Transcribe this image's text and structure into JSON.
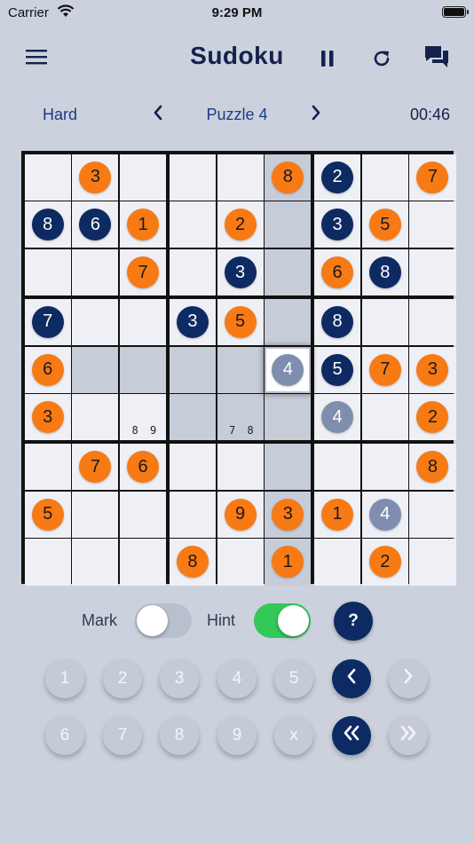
{
  "status": {
    "carrier": "Carrier",
    "time": "9:29 PM"
  },
  "nav": {
    "title": "Sudoku",
    "menu_icon": "hamburger-menu-icon",
    "pause_icon": "pause-icon",
    "restart_icon": "refresh-icon",
    "chat_icon": "chat-bubbles-icon"
  },
  "puzzle": {
    "difficulty": "Hard",
    "label": "Puzzle 4",
    "timer": "00:46"
  },
  "colors": {
    "orange": "#f77a14",
    "navy": "#0e2a63",
    "gray": "#7f8eae",
    "highlight": "#c7ccd9",
    "toggle_on": "#34c759"
  },
  "board": {
    "rows": [
      [
        null,
        {
          "v": "3",
          "c": "orange"
        },
        null,
        null,
        null,
        {
          "v": "8",
          "c": "orange"
        },
        {
          "v": "2",
          "c": "navy"
        },
        null,
        {
          "v": "7",
          "c": "orange"
        }
      ],
      [
        {
          "v": "8",
          "c": "navy"
        },
        {
          "v": "6",
          "c": "navy"
        },
        {
          "v": "1",
          "c": "orange"
        },
        null,
        {
          "v": "2",
          "c": "orange"
        },
        null,
        {
          "v": "3",
          "c": "navy"
        },
        {
          "v": "5",
          "c": "orange"
        },
        null
      ],
      [
        null,
        null,
        {
          "v": "7",
          "c": "orange"
        },
        null,
        {
          "v": "3",
          "c": "navy"
        },
        null,
        {
          "v": "6",
          "c": "orange"
        },
        {
          "v": "8",
          "c": "navy"
        },
        null
      ],
      [
        {
          "v": "7",
          "c": "navy"
        },
        null,
        null,
        {
          "v": "3",
          "c": "navy"
        },
        {
          "v": "5",
          "c": "orange"
        },
        null,
        {
          "v": "8",
          "c": "navy"
        },
        null,
        null
      ],
      [
        {
          "v": "6",
          "c": "orange"
        },
        null,
        null,
        null,
        null,
        {
          "v": "4",
          "c": "gray"
        },
        {
          "v": "5",
          "c": "navy"
        },
        {
          "v": "7",
          "c": "orange"
        },
        {
          "v": "3",
          "c": "orange"
        }
      ],
      [
        {
          "v": "3",
          "c": "orange"
        },
        null,
        {
          "notes": "8 9"
        },
        null,
        {
          "notes": "7 8"
        },
        null,
        {
          "v": "4",
          "c": "gray"
        },
        null,
        {
          "v": "2",
          "c": "orange"
        }
      ],
      [
        null,
        {
          "v": "7",
          "c": "orange"
        },
        {
          "v": "6",
          "c": "orange"
        },
        null,
        null,
        null,
        null,
        null,
        {
          "v": "8",
          "c": "orange"
        }
      ],
      [
        {
          "v": "5",
          "c": "orange"
        },
        null,
        null,
        null,
        {
          "v": "9",
          "c": "orange"
        },
        {
          "v": "3",
          "c": "orange"
        },
        {
          "v": "1",
          "c": "orange"
        },
        {
          "v": "4",
          "c": "gray"
        },
        null
      ],
      [
        null,
        null,
        null,
        {
          "v": "8",
          "c": "orange"
        },
        null,
        {
          "v": "1",
          "c": "orange"
        },
        null,
        {
          "v": "2",
          "c": "orange"
        },
        null
      ]
    ],
    "selected": [
      4,
      5
    ],
    "highlighted": [
      [
        0,
        5
      ],
      [
        1,
        5
      ],
      [
        2,
        5
      ],
      [
        3,
        5
      ],
      [
        5,
        5
      ],
      [
        6,
        5
      ],
      [
        7,
        5
      ],
      [
        8,
        5
      ],
      [
        4,
        1
      ],
      [
        4,
        2
      ],
      [
        4,
        3
      ],
      [
        4,
        4
      ],
      [
        3,
        5
      ],
      [
        5,
        3
      ],
      [
        5,
        4
      ]
    ]
  },
  "controls": {
    "mark_label": "Mark",
    "mark_on": false,
    "hint_label": "Hint",
    "hint_on": true,
    "help_label": "?"
  },
  "keypad": {
    "row1": [
      "1",
      "2",
      "3",
      "4",
      "5"
    ],
    "row2": [
      "6",
      "7",
      "8",
      "9",
      "x"
    ],
    "undo_icon": "chevron-left-icon",
    "redo_icon": "chevron-right-icon",
    "undo_all_icon": "double-chevron-left-icon",
    "redo_all_icon": "double-chevron-right-icon"
  }
}
